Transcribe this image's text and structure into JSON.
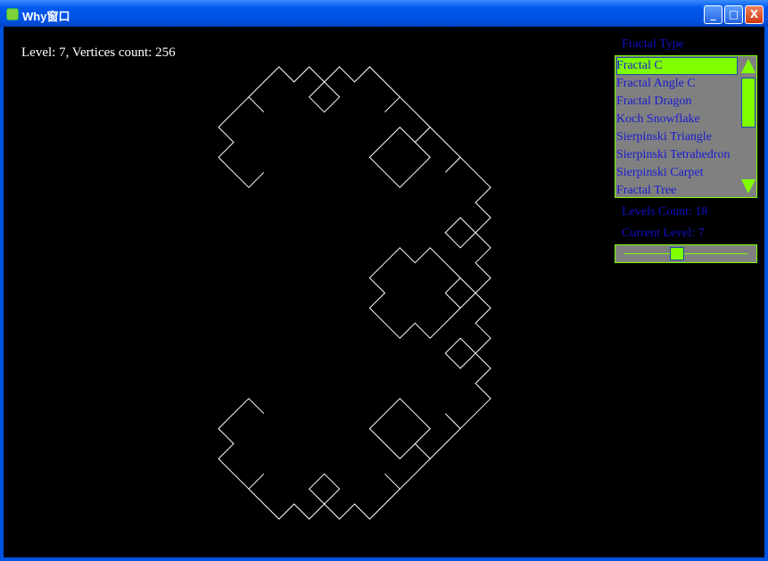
{
  "window": {
    "title": "Why窗口",
    "minimize": "_",
    "maximize": "□",
    "close": "X"
  },
  "status": "Level: 7, Vertices count: 256",
  "panel": {
    "fractal_type_label": "Fractal Type",
    "items": [
      "Fractal C",
      "Fractal Angle C",
      "Fractal Dragon",
      "Koch Snowflake",
      "Sierpinski Triangle",
      "Sierpinski Tetrahedron",
      "Sierpinski Carpet",
      "Fractal Tree"
    ],
    "selected": "Fractal C",
    "levels_count_label": "Levels Count: 18",
    "current_level_label": "Current Level: 7",
    "levels_count": 18,
    "current_level": 7
  },
  "fractal": {
    "type": "Levy C curve",
    "level": 7,
    "line_color": "#ffffff"
  },
  "colors": {
    "accent": "#80ff00",
    "text": "#1a1ad0",
    "list_bg": "#808080"
  }
}
